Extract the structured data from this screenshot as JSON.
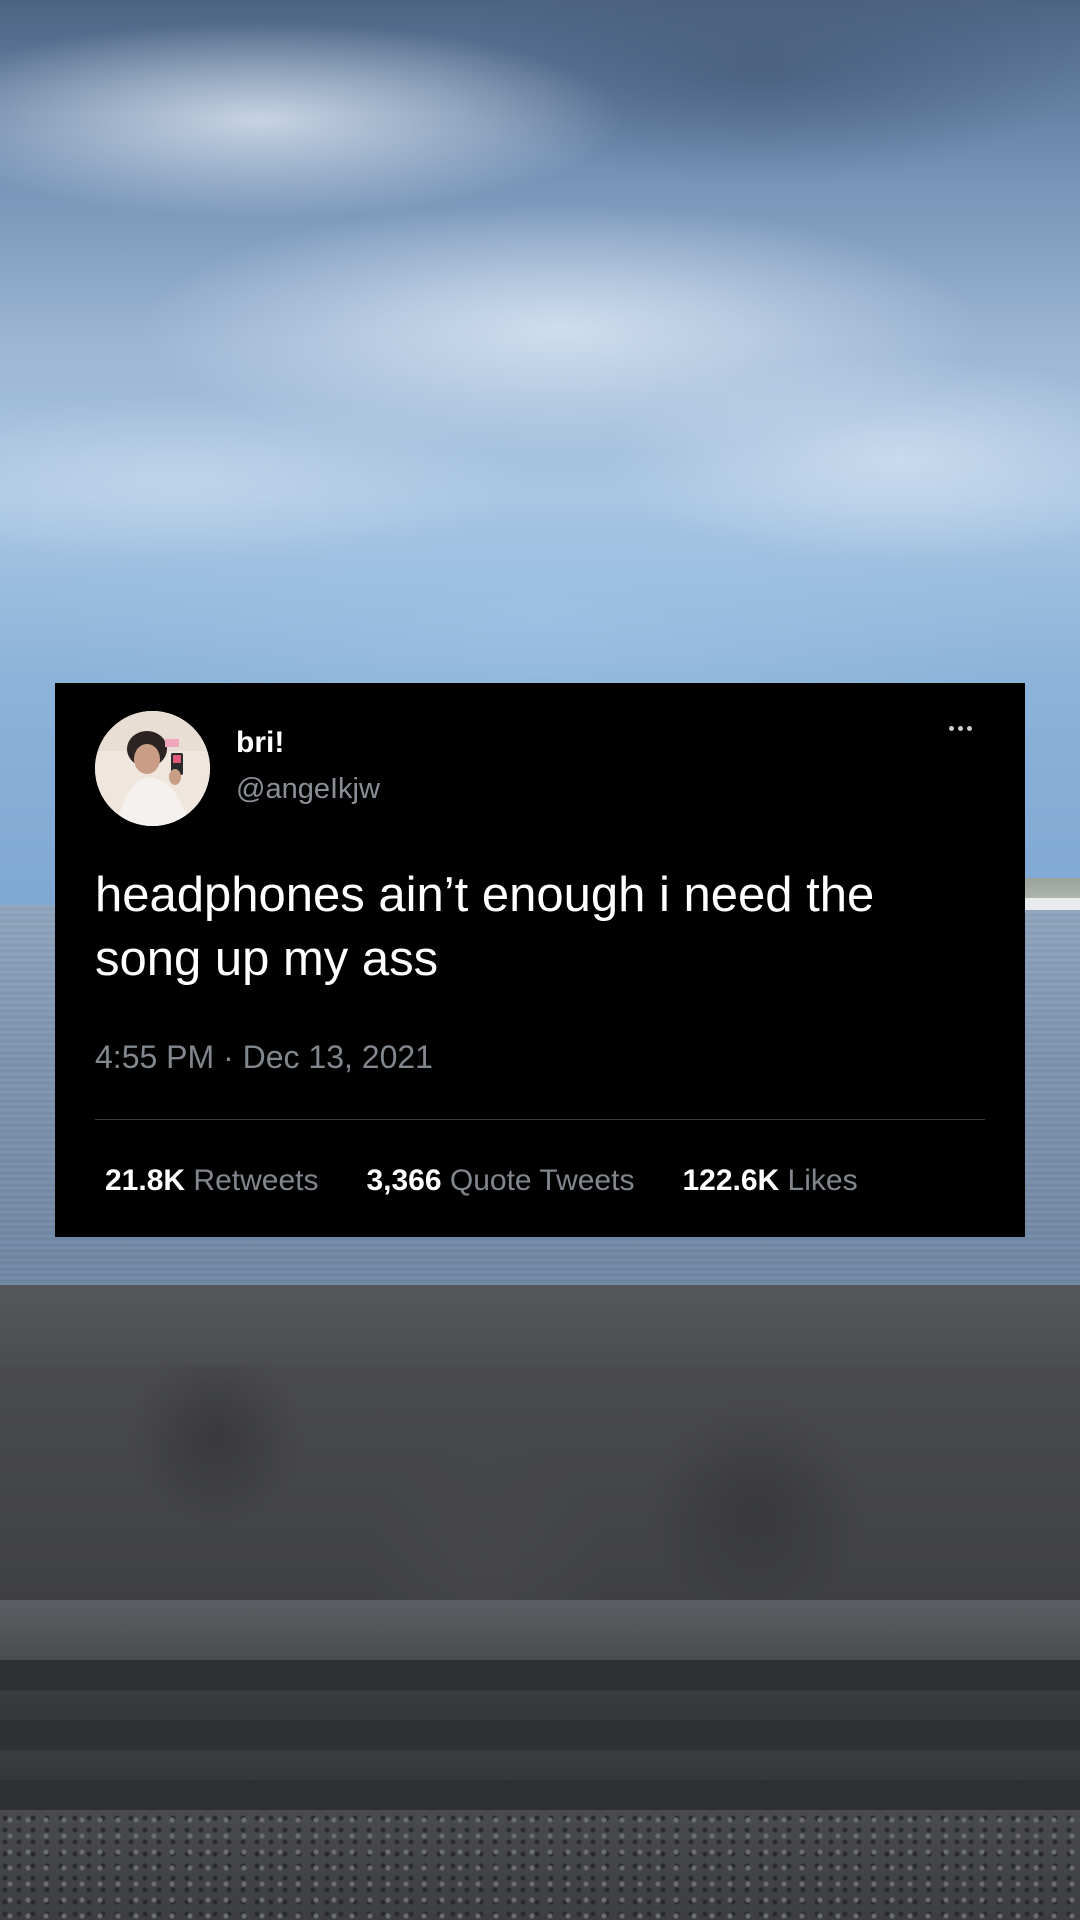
{
  "tweet": {
    "display_name": "bri!",
    "handle": "@angeIkjw",
    "text": "headphones ain’t enough i need the song up my ass",
    "timestamp": "4:55 PM · Dec 13, 2021",
    "stats": [
      {
        "count": "21.8K",
        "label": "Retweets"
      },
      {
        "count": "3,366",
        "label": "Quote Tweets"
      },
      {
        "count": "122.6K",
        "label": "Likes"
      }
    ],
    "more_icon": "more-horizontal-icon"
  },
  "colors": {
    "card_background": "#000000",
    "text_primary": "#ffffff",
    "text_secondary": "#82878d",
    "divider": "#3a3d40"
  }
}
